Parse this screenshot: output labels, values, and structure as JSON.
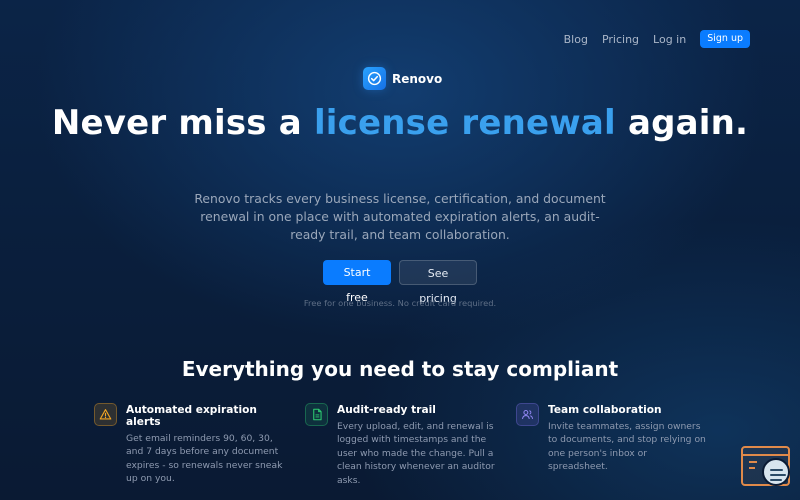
{
  "nav": {
    "blog": "Blog",
    "pricing": "Pricing",
    "login": "Log in",
    "signup": "Sign up"
  },
  "brand": {
    "name": "Renovo",
    "icon": "check-circle-icon"
  },
  "hero": {
    "title_part1": "Never miss a ",
    "title_accent": "license renewal",
    "title_part2": " again.",
    "subtitle": "Renovo tracks every business license, certification, and document renewal in one place with automated expiration alerts, an audit-ready trail, and team collaboration.",
    "cta_primary": "Start free",
    "cta_secondary": "See pricing",
    "fine_print": "Free for one business. No credit card required."
  },
  "features": {
    "heading": "Everything you need to stay compliant",
    "items": [
      {
        "icon": "warning-icon",
        "title": "Automated expiration alerts",
        "description": "Get email reminders 90, 60, 30, and 7 days before any document expires - so renewals never sneak up on you."
      },
      {
        "icon": "document-icon",
        "title": "Audit-ready trail",
        "description": "Every upload, edit, and renewal is logged with timestamps and the user who made the change. Pull a clean history whenever an auditor asks."
      },
      {
        "icon": "team-icon",
        "title": "Team collaboration",
        "description": "Invite teammates, assign owners to documents, and stop relying on one person's inbox or spreadsheet."
      }
    ]
  },
  "colors": {
    "accent": "#3aa0ee",
    "primary_button": "#0a7cff",
    "background": "#0a1f3d"
  }
}
